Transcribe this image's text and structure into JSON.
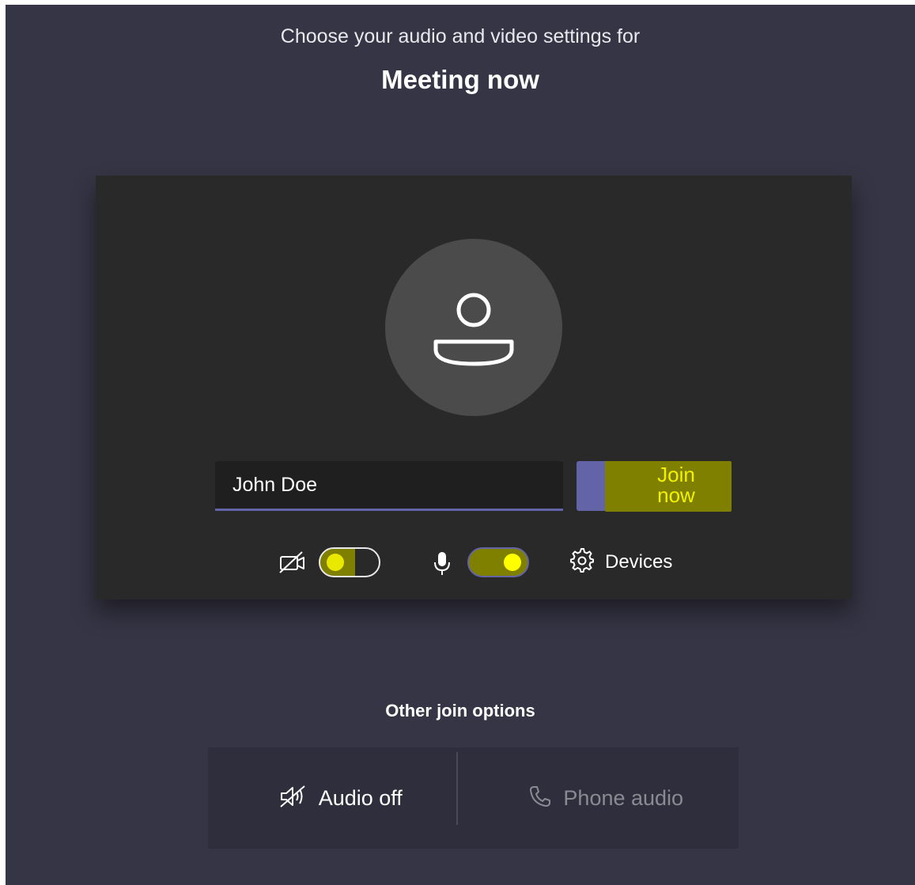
{
  "header": {
    "subtitle": "Choose your audio and video settings for",
    "meeting_title": "Meeting now"
  },
  "preview": {
    "name_input_value": "John Doe",
    "join_label": "Join now",
    "camera_toggle": {
      "icon": "camera-off-icon",
      "state": "off"
    },
    "mic_toggle": {
      "icon": "microphone-icon",
      "state": "on"
    },
    "devices_label": "Devices",
    "devices_icon": "gear-icon"
  },
  "other_options": {
    "title": "Other join options",
    "audio_off_label": "Audio off",
    "audio_off_icon": "speaker-off-icon",
    "phone_audio_label": "Phone audio",
    "phone_audio_icon": "phone-icon"
  },
  "colors": {
    "background": "#363545",
    "panel": "#292929",
    "accent": "#6264a7",
    "highlight": "#808000",
    "highlight_text": "#f2f200"
  }
}
